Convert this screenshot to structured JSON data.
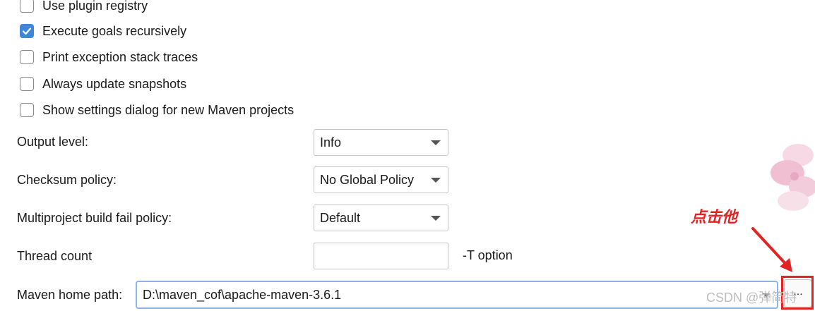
{
  "checkboxes": [
    {
      "label": "Use plugin registry",
      "checked": false
    },
    {
      "label": "Execute goals recursively",
      "checked": true
    },
    {
      "label": "Print exception stack traces",
      "checked": false
    },
    {
      "label": "Always update snapshots",
      "checked": false
    },
    {
      "label": "Show settings dialog for new Maven projects",
      "checked": false
    }
  ],
  "fields": {
    "output_level": {
      "label": "Output level:",
      "value": "Info"
    },
    "checksum_policy": {
      "label": "Checksum policy:",
      "value": "No Global Policy"
    },
    "fail_policy": {
      "label": "Multiproject build fail policy:",
      "value": "Default"
    },
    "thread_count": {
      "label": "Thread count",
      "value": "",
      "suffix": "-T option"
    },
    "maven_home": {
      "label": "Maven home path:",
      "value": "D:\\maven_cof\\apache-maven-3.6.1",
      "browse_label": "..."
    }
  },
  "annotation": {
    "text": "点击他",
    "color": "#e32222"
  },
  "watermark": "CSDN @弹简特",
  "colors": {
    "accent": "#3d86d8",
    "focus_border": "#8cb4ea",
    "highlight": "#e32222"
  },
  "icons": {
    "checkmark": "checkmark-icon",
    "dropdown": "chevron-down-icon",
    "arrow": "red-arrow",
    "decoration": "flower"
  }
}
